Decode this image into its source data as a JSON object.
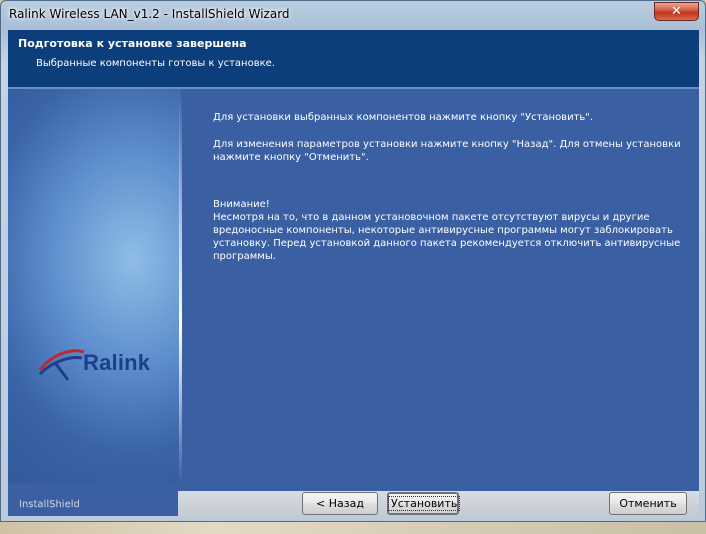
{
  "window": {
    "title": "Ralink Wireless LAN_v1.2 - InstallShield Wizard",
    "close_symbol": "✕"
  },
  "header": {
    "title": "Подготовка к установке завершена",
    "subtitle": "Выбранные компоненты готовы к установке."
  },
  "logo": {
    "text": "Ralink",
    "icon": "ralink-swoosh-icon"
  },
  "content": {
    "p1": "Для установки выбранных компонентов нажмите кнопку \"Установить\".",
    "p2": "Для изменения параметров установки нажмите кнопку \"Назад\". Для отмены установки нажмите кнопку \"Отменить\".",
    "warning_title": "Внимание!",
    "warning_body": "Несмотря на то, что в данном установочном пакете отсутствуют вирусы и другие вредоносные компоненты, некоторые антивирусные программы могут заблокировать установку. Перед установкой данного пакета рекомендуется отключить антивирусные программы."
  },
  "footer": {
    "brand": "InstallShield",
    "back_label": "< Назад",
    "install_label": "Установить",
    "cancel_label": "Отменить"
  },
  "colors": {
    "header_bg": "#0d3e7c",
    "client_bg": "#3a5fa3",
    "logo_blue": "#1c3f8c",
    "logo_red": "#c0282d"
  }
}
